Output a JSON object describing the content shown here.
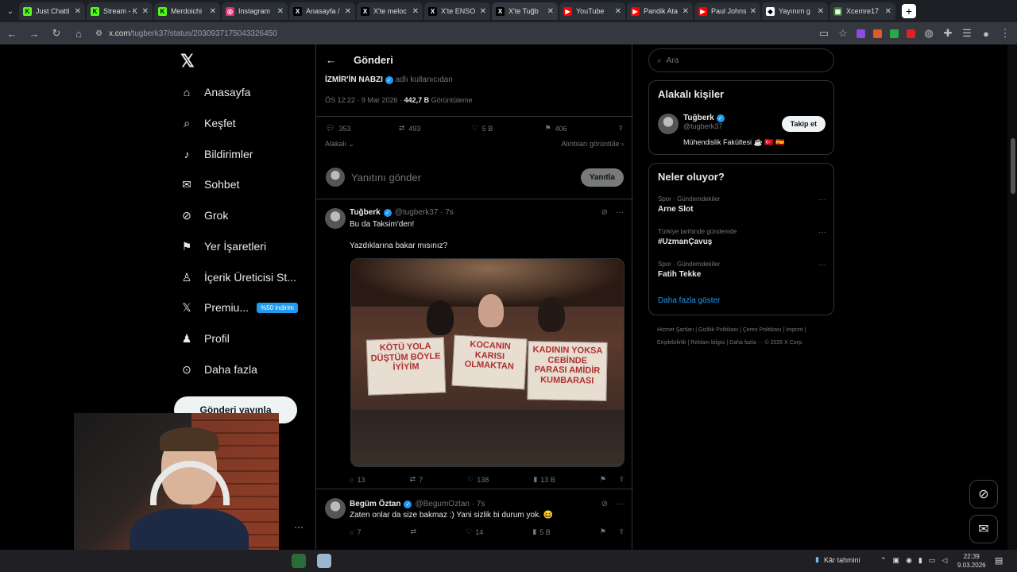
{
  "browser": {
    "tabs": [
      {
        "label": "Just Chatti",
        "fav_color": "#53fc18",
        "fav_text": "K"
      },
      {
        "label": "Stream - K",
        "fav_color": "#53fc18",
        "fav_text": "K"
      },
      {
        "label": "Merdoichi",
        "fav_color": "#53fc18",
        "fav_text": "K"
      },
      {
        "label": "Instagram",
        "fav_color": "#e1306c",
        "fav_text": "◎"
      },
      {
        "label": "Anasayfa /",
        "fav_color": "#000000",
        "fav_text": "X"
      },
      {
        "label": "X'te meloc",
        "fav_color": "#000000",
        "fav_text": "X"
      },
      {
        "label": "X'te ENSO",
        "fav_color": "#000000",
        "fav_text": "X"
      },
      {
        "label": "X'te Tuğb",
        "fav_color": "#000000",
        "fav_text": "X"
      },
      {
        "label": "YouTube",
        "fav_color": "#ff0000",
        "fav_text": "▶"
      },
      {
        "label": "Pandik Ata",
        "fav_color": "#ff0000",
        "fav_text": "▶"
      },
      {
        "label": "Paul Johns",
        "fav_color": "#ff0000",
        "fav_text": "▶"
      },
      {
        "label": "Yayınım g",
        "fav_color": "#ffffff",
        "fav_text": "◆"
      },
      {
        "label": "Xcemre17",
        "fav_color": "#2b7a2b",
        "fav_text": "▦"
      }
    ],
    "active_tab_index": 7,
    "url_domain": "x.com",
    "url_path": "/tugberk37/status/2030937175043326450"
  },
  "nav": {
    "items": [
      {
        "label": "Anasayfa",
        "icon": "home-icon"
      },
      {
        "label": "Keşfet",
        "icon": "search-icon"
      },
      {
        "label": "Bildirimler",
        "icon": "bell-icon"
      },
      {
        "label": "Sohbet",
        "icon": "mail-icon"
      },
      {
        "label": "Grok",
        "icon": "grok-icon"
      },
      {
        "label": "Yer İşaretleri",
        "icon": "bookmark-icon"
      },
      {
        "label": "İçerik Üreticisi St...",
        "icon": "creator-icon"
      },
      {
        "label": "Premiu...",
        "icon": "x-premium-icon"
      },
      {
        "label": "Profil",
        "icon": "person-icon"
      },
      {
        "label": "Daha fazla",
        "icon": "more-circle-icon"
      }
    ],
    "premium_badge": "%50 indirim",
    "post_button": "Gönderi yayınla"
  },
  "post": {
    "header_title": "Gönderi",
    "source_name": "İZMİR'İN NABZI",
    "source_suffix": "adlı kullanıcıdan",
    "time": "ÖS 12:22 · 9 Mar 2026 ·",
    "views_count": "442,7 B",
    "views_label": "Görüntüleme",
    "stats": {
      "replies": "353",
      "reposts": "493",
      "likes": "5 B",
      "bookmarks": "406"
    },
    "sort_label": "Alakalı",
    "quotes_label": "Alıntıları görüntüle",
    "reply_placeholder": "Yanıtını gönder",
    "reply_button": "Yanıtla"
  },
  "replies": [
    {
      "name": "Tuğberk",
      "handle": "@tugberk37 · 7s",
      "text1": "Bu da Taksim'den!",
      "text2": "Yazdıklarına bakar mısınız?",
      "stats": {
        "replies": "13",
        "reposts": "7",
        "likes": "138",
        "views": "13 B"
      },
      "photo_signs": [
        "KÖTÜ YOLA DÜŞTÜM BÖYLE İYİYİM",
        "KOCANIN KARISI OLMAKTAN",
        "KADININ YOKSA CEBİNDE PARASI AMİDİR KUMBARASI"
      ]
    },
    {
      "name": "Begüm Öztan",
      "handle": "@BegumOztan · 7s",
      "text1": "Zaten onlar da size bakmaz :) Yani sizlik bi durum yok. 😆",
      "stats": {
        "replies": "7",
        "reposts": "",
        "likes": "14",
        "views": "5 B"
      }
    }
  ],
  "sidebar": {
    "search_placeholder": "Ara",
    "related_title": "Alakalı kişiler",
    "related_person": {
      "name": "Tuğberk",
      "handle": "@tugberk37",
      "bio": "Mühendislik Fakültesi ☕ 🇹🇷 🇪🇸",
      "follow_label": "Takip et"
    },
    "trends_title": "Neler oluyor?",
    "trends": [
      {
        "category": "Spor · Gündemdekiler",
        "name": "Arne Slot"
      },
      {
        "category": "Türkiye tarihinde gündemde",
        "name": "#UzmanÇavuş"
      },
      {
        "category": "Spor · Gündemdekiler",
        "name": "Fatih Tekke"
      }
    ],
    "show_more": "Daha fazla göster",
    "footer": "Hizmet Şartları | Gizlilik Politikası | Çerez Politikası | Imprint | Erişilebilirlik | Reklam bilgisi | Daha fazla ··· © 2026 X Corp."
  },
  "taskbar": {
    "weather": "Kâr tahmini",
    "time": "22:39",
    "date": "9.03.2026"
  }
}
